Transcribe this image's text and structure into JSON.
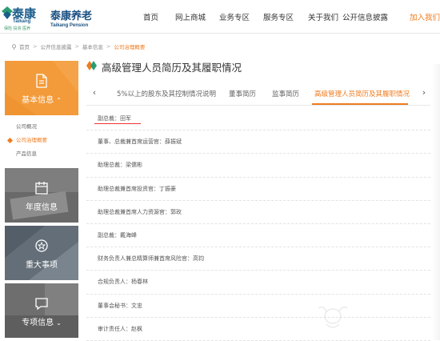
{
  "header": {
    "logo_taikang_cn": "泰康",
    "logo_taikang_en": "Taikang",
    "logo_slogan": "保险 投资 医养",
    "logo_pension_cn": "泰康养老",
    "logo_pension_en": "Taikang Pension",
    "nav": [
      "首页",
      "网上商城",
      "业务专区",
      "服务专区",
      "关于我们",
      "公开信息披露",
      "加入我们"
    ],
    "nav_active_color": "#f07b1e"
  },
  "breadcrumb": [
    "首页",
    "公开信息披露",
    "基本信息",
    "公司治理概要"
  ],
  "sidebar": {
    "cards": [
      {
        "label": "基本信息",
        "icon": "document-icon",
        "chevron": "^"
      },
      {
        "label": "年度信息",
        "icon": "calendar-icon"
      },
      {
        "label": "重大事项",
        "icon": "star-circle-icon"
      },
      {
        "label": "专项信息",
        "icon": "chat-icon",
        "chevron": "v"
      }
    ],
    "sub_items": [
      "公司概况",
      "公司治理概要",
      "产品信息"
    ],
    "active_sub": "公司治理概要",
    "accent_color": "#f39b3a"
  },
  "main": {
    "title": "高级管理人员简历及其履职情况",
    "tabs": [
      "5%以上的股东及其控制情况说明",
      "董事简历",
      "监事简历",
      "高级管理人员简历及其履职情况"
    ],
    "active_tab": "高级管理人员简历及其履职情况",
    "rows": [
      "副总裁：田军",
      "董事、总裁兼首席运营官：薛振斌",
      "助理总裁：梁儒彬",
      "助理总裁兼首席投资官：丁振豪",
      "助理总裁兼首席人力资源官：郭玫",
      "副总裁：戴海峰",
      "财务负责人兼总精算师兼首席风险官：高钧",
      "合规负责人：杨春林",
      "董事会秘书：文忠",
      "审计责任人：赵枫"
    ]
  }
}
